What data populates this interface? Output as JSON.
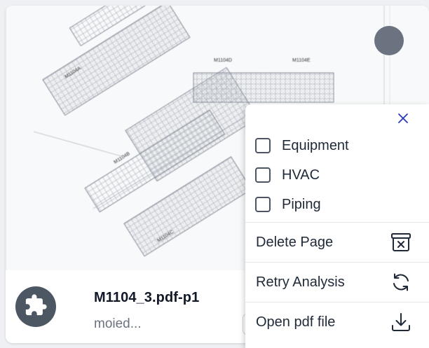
{
  "card": {
    "thumbnail": {
      "labels": [
        "M1104A",
        "M1104B",
        "M1104C",
        "M1104D",
        "M1104E"
      ]
    },
    "file_name": "M1104_3.pdf-p1",
    "file_status": "moied...",
    "badge_icon": "puzzle-icon"
  },
  "menu": {
    "close_icon": "close-icon",
    "filters": [
      {
        "label": "Equipment",
        "checked": false
      },
      {
        "label": "HVAC",
        "checked": false
      },
      {
        "label": "Piping",
        "checked": false
      }
    ],
    "actions": [
      {
        "label": "Delete Page",
        "icon": "archive-x-icon"
      },
      {
        "label": "Retry Analysis",
        "icon": "refresh-icon"
      },
      {
        "label": "Open pdf file",
        "icon": "download-icon"
      }
    ]
  },
  "colors": {
    "accent": "#2b3bb8",
    "badge": "#4d5663",
    "avatar": "#6b7280"
  }
}
